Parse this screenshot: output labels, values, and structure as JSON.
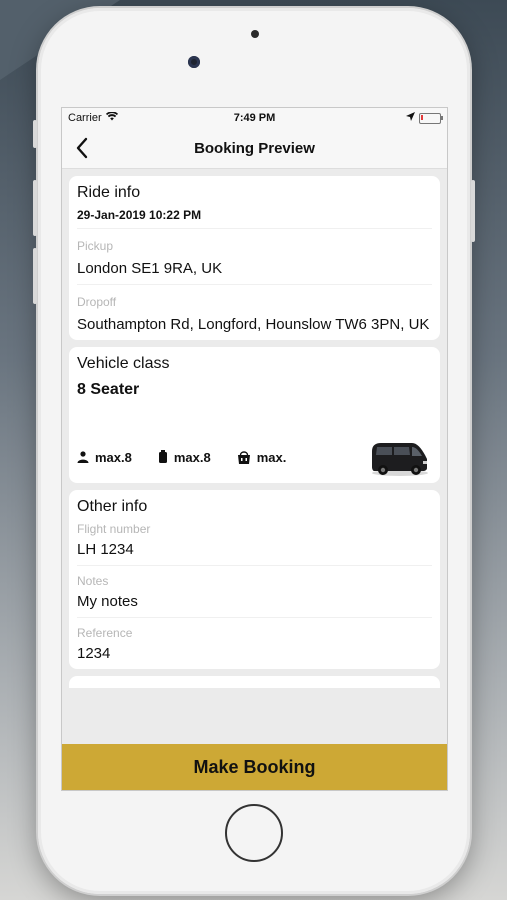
{
  "status_bar": {
    "carrier": "Carrier",
    "time": "7:49 PM"
  },
  "nav": {
    "title": "Booking Preview"
  },
  "ride_info": {
    "title": "Ride info",
    "datetime": "29-Jan-2019 10:22 PM",
    "pickup_label": "Pickup",
    "pickup_value": "London SE1 9RA, UK",
    "dropoff_label": "Dropoff",
    "dropoff_value": "Southampton Rd, Longford, Hounslow TW6 3PN, UK"
  },
  "vehicle": {
    "title": "Vehicle class",
    "name": "8 Seater",
    "passengers": "max.8",
    "luggage": "max.8",
    "bags": "max."
  },
  "other_info": {
    "title": "Other info",
    "flight_label": "Flight number",
    "flight_value": "LH 1234",
    "notes_label": "Notes",
    "notes_value": "My notes",
    "reference_label": "Reference",
    "reference_value": "1234"
  },
  "actions": {
    "make_booking": "Make Booking"
  },
  "colors": {
    "accent": "#cda835"
  }
}
